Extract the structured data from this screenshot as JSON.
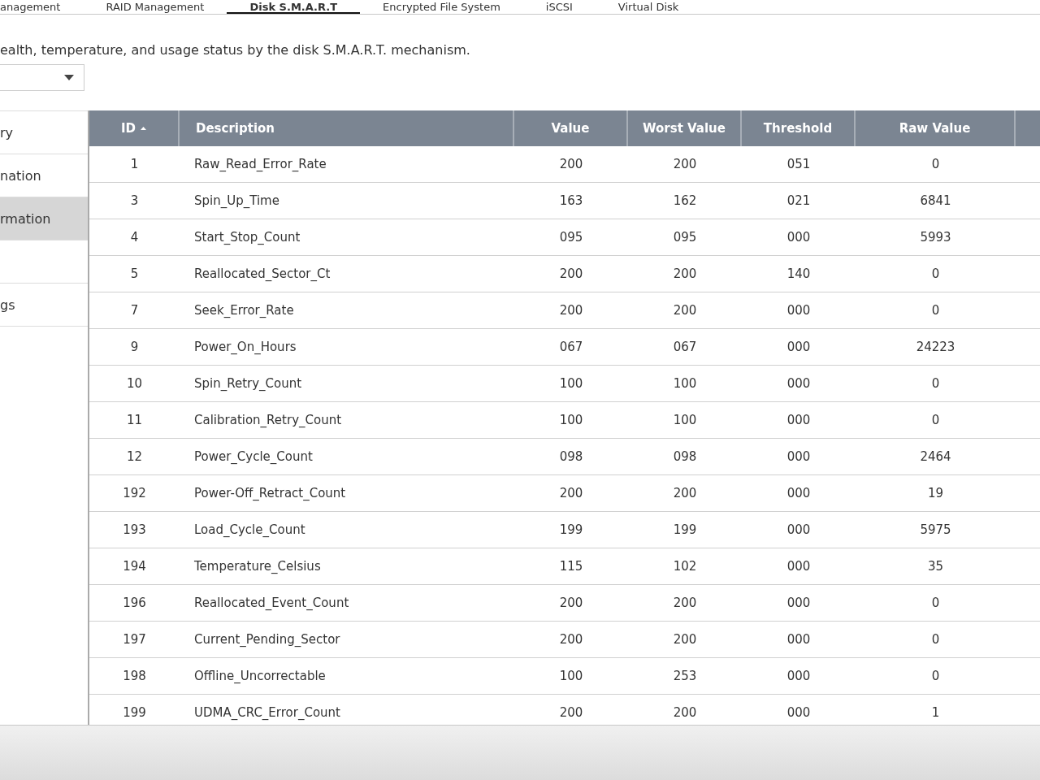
{
  "tabs": [
    {
      "label": "anagement",
      "selected": false
    },
    {
      "label": "RAID Management",
      "selected": false
    },
    {
      "label": "Disk S.M.A.R.T",
      "selected": true
    },
    {
      "label": "Encrypted File System",
      "selected": false
    },
    {
      "label": "iSCSI",
      "selected": false
    },
    {
      "label": "Virtual Disk",
      "selected": false
    }
  ],
  "description": "ealth, temperature, and usage status by the disk S.M.A.R.T. mechanism.",
  "sidebar": {
    "items": [
      {
        "label": "ry",
        "selected": false
      },
      {
        "label": "nation",
        "selected": false
      },
      {
        "label": "rmation",
        "selected": true
      },
      {
        "selected": false
      },
      {
        "label": "gs",
        "selected": false
      }
    ]
  },
  "table": {
    "columns": [
      {
        "label": "ID",
        "sorted": true
      },
      {
        "label": "Description",
        "sorted": false
      },
      {
        "label": "Value",
        "sorted": false
      },
      {
        "label": "Worst Value",
        "sorted": false
      },
      {
        "label": "Threshold",
        "sorted": false
      },
      {
        "label": "Raw Value",
        "sorted": false
      },
      {
        "sorted": false
      }
    ],
    "rows": [
      [
        "1",
        "Raw_Read_Error_Rate",
        "200",
        "200",
        "051",
        "0"
      ],
      [
        "3",
        "Spin_Up_Time",
        "163",
        "162",
        "021",
        "6841"
      ],
      [
        "4",
        "Start_Stop_Count",
        "095",
        "095",
        "000",
        "5993"
      ],
      [
        "5",
        "Reallocated_Sector_Ct",
        "200",
        "200",
        "140",
        "0"
      ],
      [
        "7",
        "Seek_Error_Rate",
        "200",
        "200",
        "000",
        "0"
      ],
      [
        "9",
        "Power_On_Hours",
        "067",
        "067",
        "000",
        "24223"
      ],
      [
        "10",
        "Spin_Retry_Count",
        "100",
        "100",
        "000",
        "0"
      ],
      [
        "11",
        "Calibration_Retry_Count",
        "100",
        "100",
        "000",
        "0"
      ],
      [
        "12",
        "Power_Cycle_Count",
        "098",
        "098",
        "000",
        "2464"
      ],
      [
        "192",
        "Power-Off_Retract_Count",
        "200",
        "200",
        "000",
        "19"
      ],
      [
        "193",
        "Load_Cycle_Count",
        "199",
        "199",
        "000",
        "5975"
      ],
      [
        "194",
        "Temperature_Celsius",
        "115",
        "102",
        "000",
        "35"
      ],
      [
        "196",
        "Reallocated_Event_Count",
        "200",
        "200",
        "000",
        "0"
      ],
      [
        "197",
        "Current_Pending_Sector",
        "200",
        "200",
        "000",
        "0"
      ],
      [
        "198",
        "Offline_Uncorrectable",
        "100",
        "253",
        "000",
        "0"
      ],
      [
        "199",
        "UDMA_CRC_Error_Count",
        "200",
        "200",
        "000",
        "1"
      ]
    ]
  }
}
